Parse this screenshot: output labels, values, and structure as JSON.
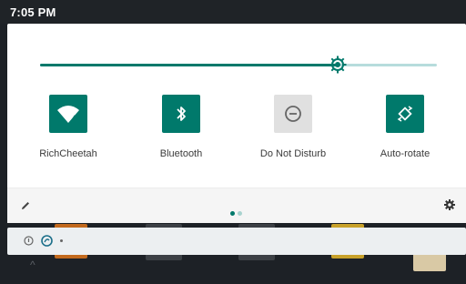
{
  "status_bar": {
    "time": "7:05 PM"
  },
  "brightness": {
    "level": 0.75
  },
  "tiles": [
    {
      "label": "RichCheetah",
      "icon": "wifi-icon",
      "active": true
    },
    {
      "label": "Bluetooth",
      "icon": "bluetooth-icon",
      "active": true
    },
    {
      "label": "Do Not Disturb",
      "icon": "do-not-disturb-icon",
      "active": false
    },
    {
      "label": "Auto-rotate",
      "icon": "auto-rotate-icon",
      "active": true
    }
  ],
  "footer": {
    "page_count": 2,
    "current_page": 1
  },
  "notification_icons": [
    "info-icon",
    "sync-icon",
    "dot-icon"
  ],
  "colors": {
    "accent": "#00796b",
    "track": "#b7dcdc",
    "inactive_tile": "#e0e0e0"
  }
}
